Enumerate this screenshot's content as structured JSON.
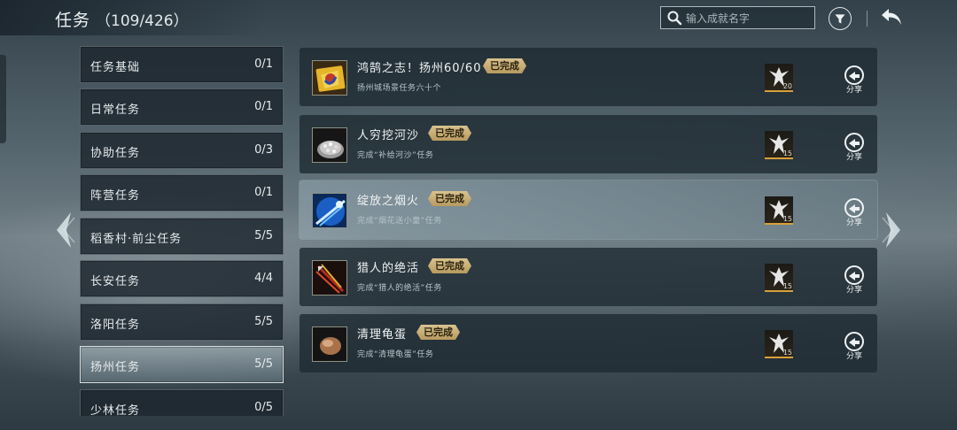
{
  "header": {
    "title": "任务",
    "count": "（109/426）",
    "search_placeholder": "输入成就名字"
  },
  "categories": [
    {
      "name": "任务基础",
      "count": "0/1",
      "active": false
    },
    {
      "name": "日常任务",
      "count": "0/1",
      "active": false
    },
    {
      "name": "协助任务",
      "count": "0/3",
      "active": false
    },
    {
      "name": "阵营任务",
      "count": "0/1",
      "active": false
    },
    {
      "name": "稻香村·前尘任务",
      "count": "5/5",
      "active": false
    },
    {
      "name": "长安任务",
      "count": "4/4",
      "active": false
    },
    {
      "name": "洛阳任务",
      "count": "5/5",
      "active": false
    },
    {
      "name": "扬州任务",
      "count": "5/5",
      "active": true
    },
    {
      "name": "少林任务",
      "count": "0/5",
      "active": false
    }
  ],
  "tasks": [
    {
      "title": "鸿鹄之志！扬州60/60",
      "badge": "已完成",
      "desc": "扬州城场景任务六十个",
      "reward_count": "20",
      "share_label": "分享",
      "icon": "flag-icon"
    },
    {
      "title": "人穷挖河沙",
      "badge": "已完成",
      "desc": "完成“补给河沙”任务",
      "reward_count": "15",
      "share_label": "分享",
      "icon": "sand-pile-icon"
    },
    {
      "title": "绽放之烟火",
      "badge": "已完成",
      "desc": "完成“烟花送小童”任务",
      "reward_count": "15",
      "share_label": "分享",
      "icon": "firework-icon"
    },
    {
      "title": "猎人的绝活",
      "badge": "已完成",
      "desc": "完成“猎人的绝活”任务",
      "reward_count": "15",
      "share_label": "分享",
      "icon": "arrows-icon"
    },
    {
      "title": "清理龟蛋",
      "badge": "已完成",
      "desc": "完成“清理龟蛋”任务",
      "reward_count": "15",
      "share_label": "分享",
      "icon": "egg-icon"
    }
  ],
  "colors": {
    "badge": "#cdb27a",
    "reward_underline": "#d8a03a",
    "active_category": "#a9bac1"
  }
}
